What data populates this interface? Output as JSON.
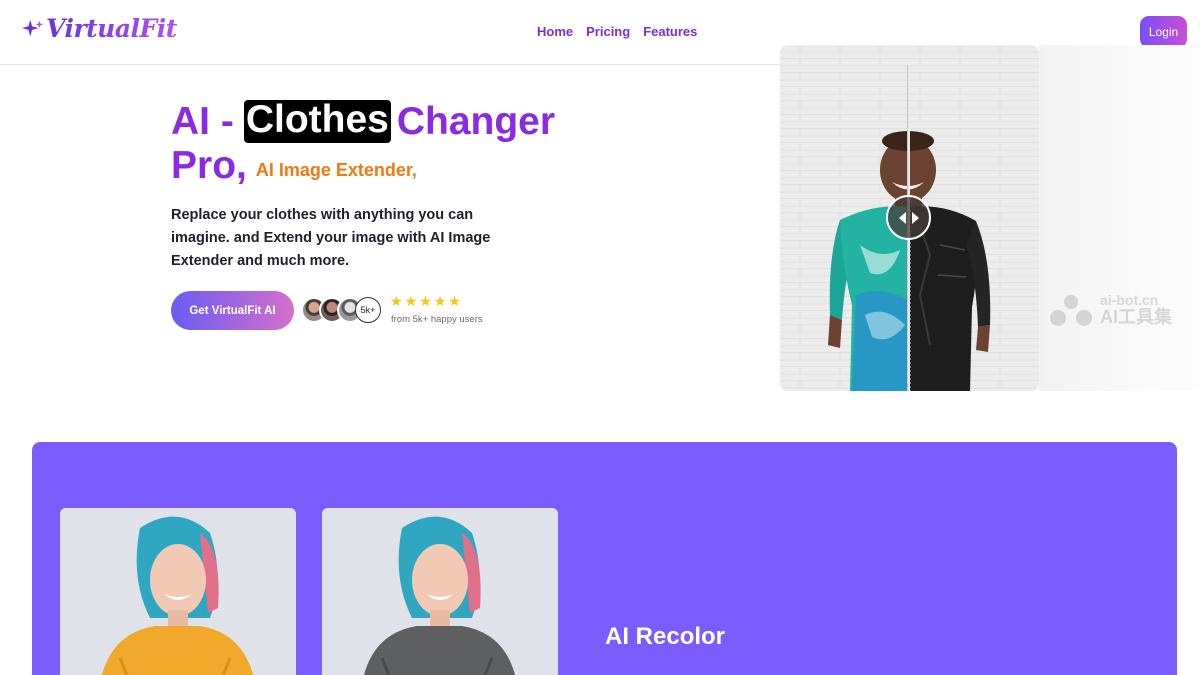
{
  "brand": {
    "name": "VirtualFit"
  },
  "nav": {
    "home": "Home",
    "pricing": "Pricing",
    "features": "Features"
  },
  "header": {
    "login_label": "Login"
  },
  "hero": {
    "title_prefix": "AI -",
    "title_highlight": "Clothes",
    "title_suffix": "Changer",
    "title_line2": "Pro,",
    "title_sub": "AI Image Extender,",
    "description": "Replace your clothes with anything you can imagine. and Extend your image with AI Image Extender and much more.",
    "cta_label": "Get VirtualFit AI",
    "users_badge": "5k+",
    "rating_text": "from 5k+ happy users",
    "stars": 5
  },
  "watermark": {
    "line1": "ai-bot.cn",
    "line2": "AI工具集"
  },
  "feature": {
    "title": "AI Recolor"
  },
  "colors": {
    "accent_purple": "#8a2be2",
    "accent_orange": "#f07a12",
    "section_bg": "#7a5cff",
    "star": "#f5c518"
  }
}
